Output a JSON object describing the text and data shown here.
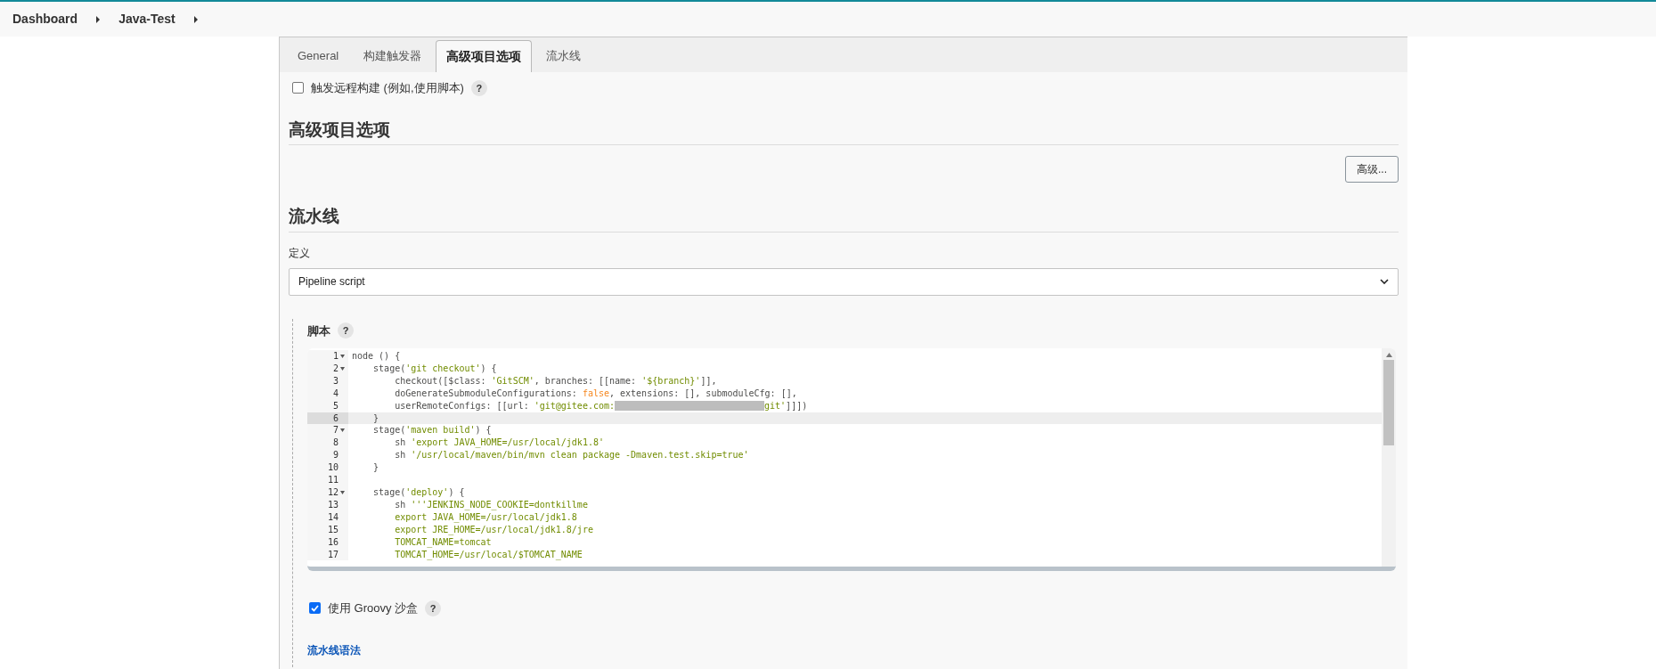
{
  "breadcrumbs": [
    {
      "label": "Dashboard"
    },
    {
      "label": "Java-Test"
    }
  ],
  "tabs": [
    {
      "label": "General",
      "selected": false
    },
    {
      "label": "构建触发器",
      "selected": false
    },
    {
      "label": "高级项目选项",
      "selected": true
    },
    {
      "label": "流水线",
      "selected": false
    }
  ],
  "trigger_option": {
    "label": "触发远程构建 (例如,使用脚本)",
    "checked": false,
    "help": "?"
  },
  "advanced_section": {
    "title": "高级项目选项",
    "button": "高级..."
  },
  "pipeline_section": {
    "title": "流水线",
    "definition_label": "定义",
    "definition_value": "Pipeline script",
    "script_label": "脚本",
    "script_help": "?",
    "code_lines": [
      {
        "number": "1",
        "foldable": true,
        "active": false,
        "tokens": [
          {
            "kind": "plain",
            "text": "node () {"
          }
        ]
      },
      {
        "number": "2",
        "foldable": true,
        "active": false,
        "tokens": [
          {
            "kind": "plain",
            "text": "    stage("
          },
          {
            "kind": "string",
            "text": "'git checkout'"
          },
          {
            "kind": "plain",
            "text": ") {"
          }
        ]
      },
      {
        "number": "3",
        "foldable": false,
        "active": false,
        "tokens": [
          {
            "kind": "plain",
            "text": "        checkout([$class: "
          },
          {
            "kind": "string",
            "text": "'GitSCM'"
          },
          {
            "kind": "plain",
            "text": ", branches: [[name: "
          },
          {
            "kind": "string",
            "text": "'${branch}'"
          },
          {
            "kind": "plain",
            "text": "]],"
          }
        ]
      },
      {
        "number": "4",
        "foldable": false,
        "active": false,
        "tokens": [
          {
            "kind": "plain",
            "text": "        doGenerateSubmoduleConfigurations: "
          },
          {
            "kind": "keyword",
            "text": "false"
          },
          {
            "kind": "plain",
            "text": ", extensions: [], submoduleCfg: [],"
          }
        ]
      },
      {
        "number": "5",
        "foldable": false,
        "active": false,
        "tokens": [
          {
            "kind": "plain",
            "text": "        userRemoteConfigs: [[url: "
          },
          {
            "kind": "string",
            "text": "'git@gitee.com:"
          },
          {
            "kind": "redacted"
          },
          {
            "kind": "string",
            "text": "git'"
          },
          {
            "kind": "plain",
            "text": "]]])"
          }
        ]
      },
      {
        "number": "6",
        "foldable": false,
        "active": true,
        "tokens": [
          {
            "kind": "plain",
            "text": "    }"
          }
        ]
      },
      {
        "number": "7",
        "foldable": true,
        "active": false,
        "tokens": [
          {
            "kind": "plain",
            "text": "    stage("
          },
          {
            "kind": "string",
            "text": "'maven build'"
          },
          {
            "kind": "plain",
            "text": ") {"
          }
        ]
      },
      {
        "number": "8",
        "foldable": false,
        "active": false,
        "tokens": [
          {
            "kind": "plain",
            "text": "        sh "
          },
          {
            "kind": "string",
            "text": "'export JAVA_HOME=/usr/local/jdk1.8'"
          }
        ]
      },
      {
        "number": "9",
        "foldable": false,
        "active": false,
        "tokens": [
          {
            "kind": "plain",
            "text": "        sh "
          },
          {
            "kind": "string",
            "text": "'/usr/local/maven/bin/mvn clean package -Dmaven.test.skip=true'"
          }
        ]
      },
      {
        "number": "10",
        "foldable": false,
        "active": false,
        "tokens": [
          {
            "kind": "plain",
            "text": "    }"
          }
        ]
      },
      {
        "number": "11",
        "foldable": false,
        "active": false
      },
      {
        "number": "12",
        "foldable": true,
        "active": false,
        "tokens": [
          {
            "kind": "plain",
            "text": "    stage("
          },
          {
            "kind": "string",
            "text": "'deploy'"
          },
          {
            "kind": "plain",
            "text": ") {"
          }
        ]
      },
      {
        "number": "13",
        "foldable": false,
        "active": false,
        "tokens": [
          {
            "kind": "plain",
            "text": "        sh "
          },
          {
            "kind": "string",
            "text": "'''JENKINS_NODE_COOKIE=dontkillme"
          }
        ]
      },
      {
        "number": "14",
        "foldable": false,
        "active": false,
        "tokens": [
          {
            "kind": "string",
            "text": "        export JAVA_HOME=/usr/local/jdk1.8"
          }
        ]
      },
      {
        "number": "15",
        "foldable": false,
        "active": false,
        "tokens": [
          {
            "kind": "string",
            "text": "        export JRE_HOME=/usr/local/jdk1.8/jre"
          }
        ]
      },
      {
        "number": "16",
        "foldable": false,
        "active": false,
        "tokens": [
          {
            "kind": "string",
            "text": "        TOMCAT_NAME=tomcat"
          }
        ]
      },
      {
        "number": "17",
        "foldable": false,
        "active": false,
        "tokens": [
          {
            "kind": "string",
            "text": "        TOMCAT_HOME=/usr/local/$TOMCAT_NAME"
          }
        ]
      }
    ],
    "sandbox_option": {
      "label": "使用 Groovy 沙盒",
      "checked": true,
      "help": "?"
    },
    "syntax_link": "流水线语法"
  }
}
